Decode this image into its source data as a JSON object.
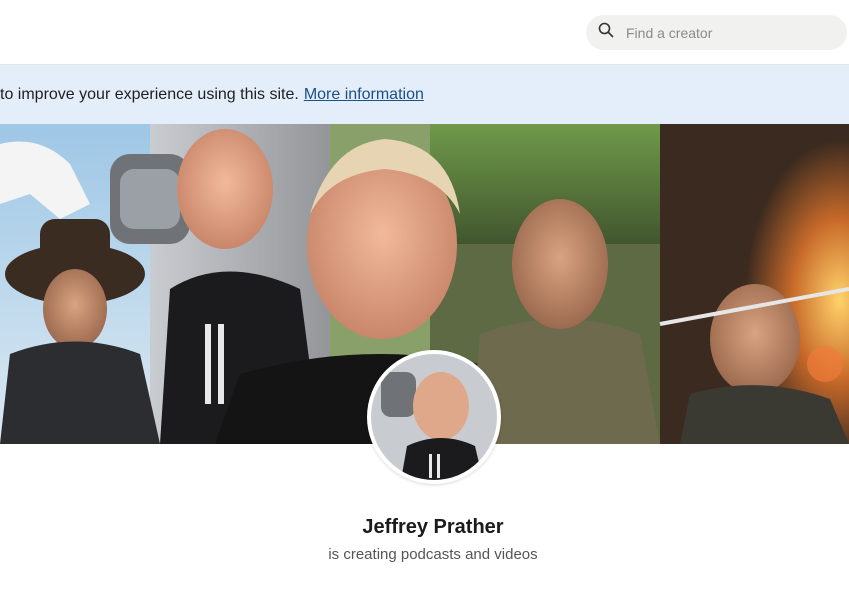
{
  "search": {
    "placeholder": "Find a creator",
    "icon": "search-icon"
  },
  "cookie_banner": {
    "text": "to improve your experience using this site.",
    "link_label": "More information"
  },
  "creator": {
    "name": "Jeffrey Prather",
    "tagline": "is creating podcasts and videos"
  },
  "colors": {
    "banner_bg": "#e4eefa",
    "link": "#1c4f87",
    "search_bg": "#f1f1ef"
  }
}
